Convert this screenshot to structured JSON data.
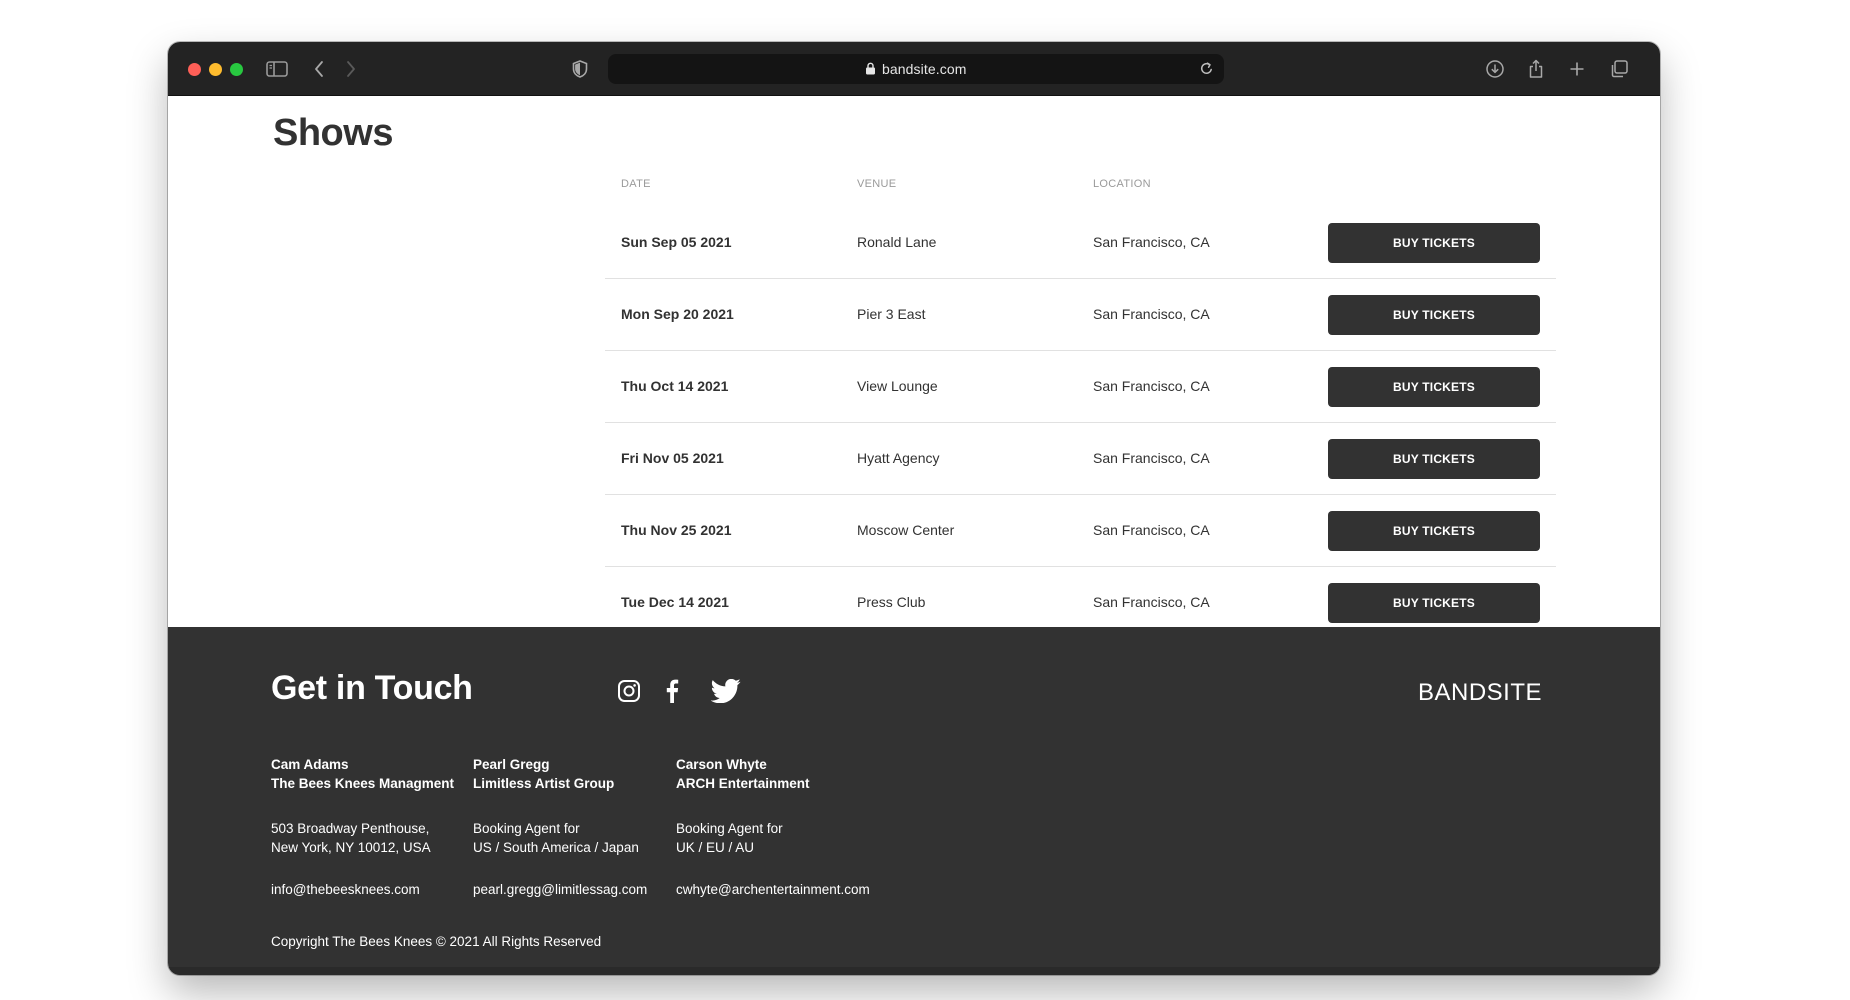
{
  "browser": {
    "url": "bandsite.com",
    "colors": {
      "chrome": "#232323",
      "address_bar": "#141414",
      "close": "#fe5f57",
      "minimize": "#febc2e",
      "zoom": "#28c840"
    }
  },
  "shows": {
    "title": "Shows",
    "columns": {
      "date": "DATE",
      "venue": "VENUE",
      "location": "LOCATION"
    },
    "rows": [
      {
        "date": "Sun Sep 05 2021",
        "venue": "Ronald Lane",
        "location": "San Francisco, CA",
        "button": "BUY TICKETS"
      },
      {
        "date": "Mon Sep 20 2021",
        "venue": "Pier 3 East",
        "location": "San Francisco, CA",
        "button": "BUY TICKETS"
      },
      {
        "date": "Thu Oct 14 2021",
        "venue": "View Lounge",
        "location": "San Francisco, CA",
        "button": "BUY TICKETS"
      },
      {
        "date": "Fri Nov 05 2021",
        "venue": "Hyatt Agency",
        "location": "San Francisco, CA",
        "button": "BUY TICKETS"
      },
      {
        "date": "Thu Nov 25 2021",
        "venue": "Moscow Center",
        "location": "San Francisco, CA",
        "button": "BUY TICKETS"
      },
      {
        "date": "Tue Dec 14 2021",
        "venue": "Press Club",
        "location": "San Francisco, CA",
        "button": "BUY TICKETS"
      }
    ],
    "colors": {
      "button_bg": "#323232",
      "button_text": "#ffffff",
      "divider": "#e1e1e1"
    }
  },
  "footer": {
    "title": "Get in Touch",
    "brand": "BANDSITE",
    "social_icons": [
      "instagram-icon",
      "facebook-icon",
      "twitter-icon"
    ],
    "contacts": [
      {
        "name": "Cam Adams",
        "org": "The Bees Knees Managment",
        "line1": "503 Broadway Penthouse,",
        "line2": "New York, NY 10012, USA",
        "email": "info@thebeesknees.com"
      },
      {
        "name": "Pearl Gregg",
        "org": "Limitless Artist Group",
        "line1": "Booking Agent for",
        "line2": "US / South America / Japan",
        "email": "pearl.gregg@limitlessag.com"
      },
      {
        "name": "Carson Whyte",
        "org": "ARCH Entertainment",
        "line1": "Booking Agent for",
        "line2": "UK / EU / AU",
        "email": "cwhyte@archentertainment.com"
      }
    ],
    "copyright": "Copyright The Bees Knees © 2021 All Rights Reserved",
    "colors": {
      "background": "#323232",
      "text": "#ffffff"
    }
  }
}
